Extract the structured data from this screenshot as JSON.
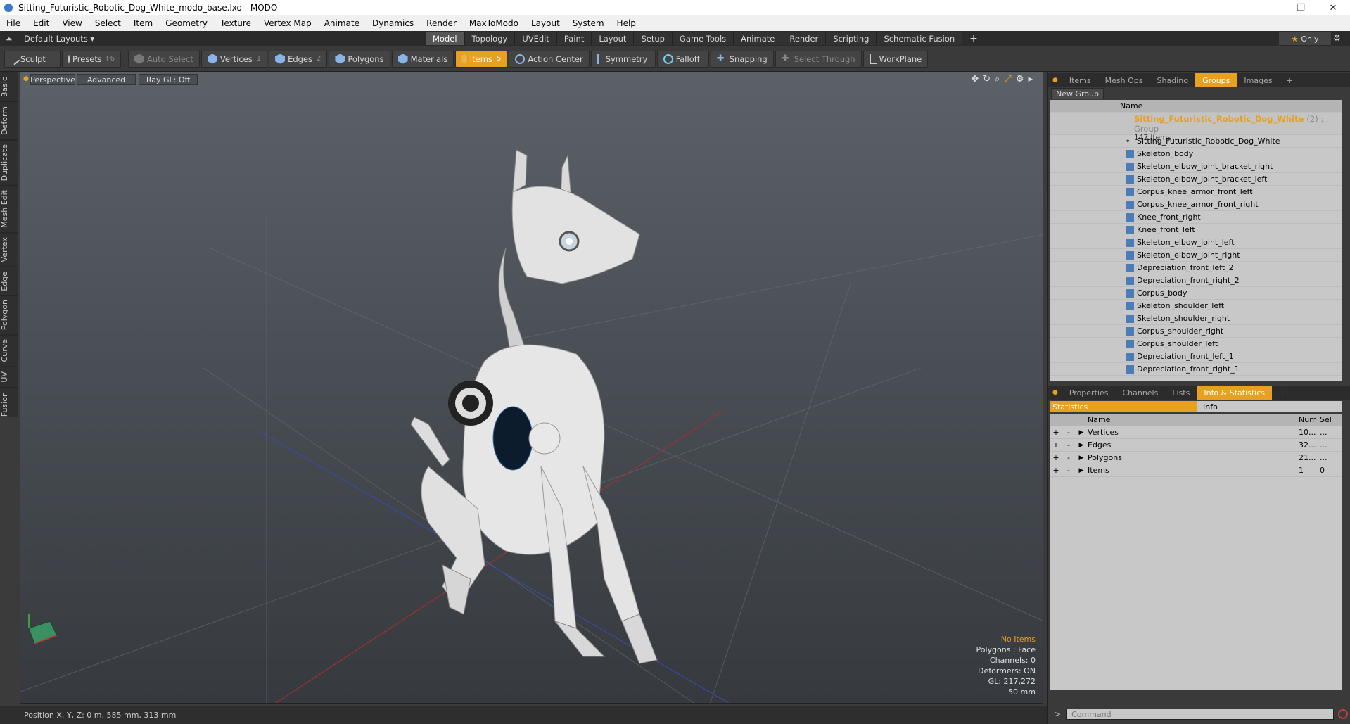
{
  "window": {
    "title": "Sitting_Futuristic_Robotic_Dog_White_modo_base.lxo - MODO"
  },
  "menu": [
    "File",
    "Edit",
    "View",
    "Select",
    "Item",
    "Geometry",
    "Texture",
    "Vertex Map",
    "Animate",
    "Dynamics",
    "Render",
    "MaxToModo",
    "Layout",
    "System",
    "Help"
  ],
  "layout": {
    "preset": "Default Layouts",
    "tabs": [
      "Model",
      "Topology",
      "UVEdit",
      "Paint",
      "Layout",
      "Setup",
      "Game Tools",
      "Animate",
      "Render",
      "Scripting",
      "Schematic Fusion"
    ],
    "active": "Model",
    "only_label": "Only"
  },
  "toolbar": {
    "sculpt": "Sculpt",
    "presets": "Presets",
    "presets_key": "F6",
    "auto_select": "Auto Select",
    "vertices": "Vertices",
    "vertices_n": "1",
    "edges": "Edges",
    "edges_n": "2",
    "polygons": "Polygons",
    "materials": "Materials",
    "items": "Items",
    "items_n": "5",
    "action_center": "Action Center",
    "symmetry": "Symmetry",
    "falloff": "Falloff",
    "snapping": "Snapping",
    "select_through": "Select Through",
    "workplane": "WorkPlane"
  },
  "lefttabs": [
    "Basic",
    "Deform",
    "Duplicate",
    "Mesh Edit",
    "Vertex",
    "Edge",
    "Polygon",
    "Curve",
    "UV",
    "Fusion"
  ],
  "viewport": {
    "view": "Perspective",
    "advanced": "Advanced",
    "raygl": "Ray GL: Off",
    "info": {
      "selection": "No Items",
      "polygons": "Polygons : Face",
      "channels": "Channels: 0",
      "deformers": "Deformers: ON",
      "gl": "GL: 217,272",
      "focal": "50 mm"
    }
  },
  "status": {
    "position": "Position X, Y, Z:  0 m, 585 mm, 313 mm"
  },
  "groups_panel": {
    "tabs": [
      "Items",
      "Mesh Ops",
      "Shading",
      "Groups",
      "Images"
    ],
    "active": "Groups",
    "new_group": "New Group",
    "col_name": "Name",
    "group_name": "Sitting_Futuristic_Robotic_Dog_White",
    "group_suffix": "(2) : Group",
    "group_count": "147 Items",
    "items": [
      "Sitting_Futuristic_Robotic_Dog_White",
      "Skeleton_body",
      "Skeleton_elbow_joint_bracket_right",
      "Skeleton_elbow_joint_bracket_left",
      "Corpus_knee_armor_front_left",
      "Corpus_knee_armor_front_right",
      "Knee_front_right",
      "Knee_front_left",
      "Skeleton_elbow_joint_left",
      "Skeleton_elbow_joint_right",
      "Depreciation_front_left_2",
      "Depreciation_front_right_2",
      "Corpus_body",
      "Skeleton_shoulder_left",
      "Skeleton_shoulder_right",
      "Corpus_shoulder_right",
      "Corpus_shoulder_left",
      "Depreciation_front_left_1",
      "Depreciation_front_right_1"
    ]
  },
  "info_panel": {
    "tabs": [
      "Properties",
      "Channels",
      "Lists",
      "Info & Statistics"
    ],
    "active": "Info & Statistics",
    "sub_tabs": [
      "Statistics",
      "Info"
    ],
    "cols": [
      "Name",
      "Num",
      "Sel"
    ],
    "rows": [
      {
        "name": "Vertices",
        "num": "10...",
        "sel": "..."
      },
      {
        "name": "Edges",
        "num": "32...",
        "sel": "..."
      },
      {
        "name": "Polygons",
        "num": "21...",
        "sel": "..."
      },
      {
        "name": "Items",
        "num": "1",
        "sel": "0"
      }
    ]
  },
  "command": {
    "placeholder": "Command"
  },
  "colors": {
    "accent": "#e8a020",
    "group_text": "#e8a020"
  }
}
